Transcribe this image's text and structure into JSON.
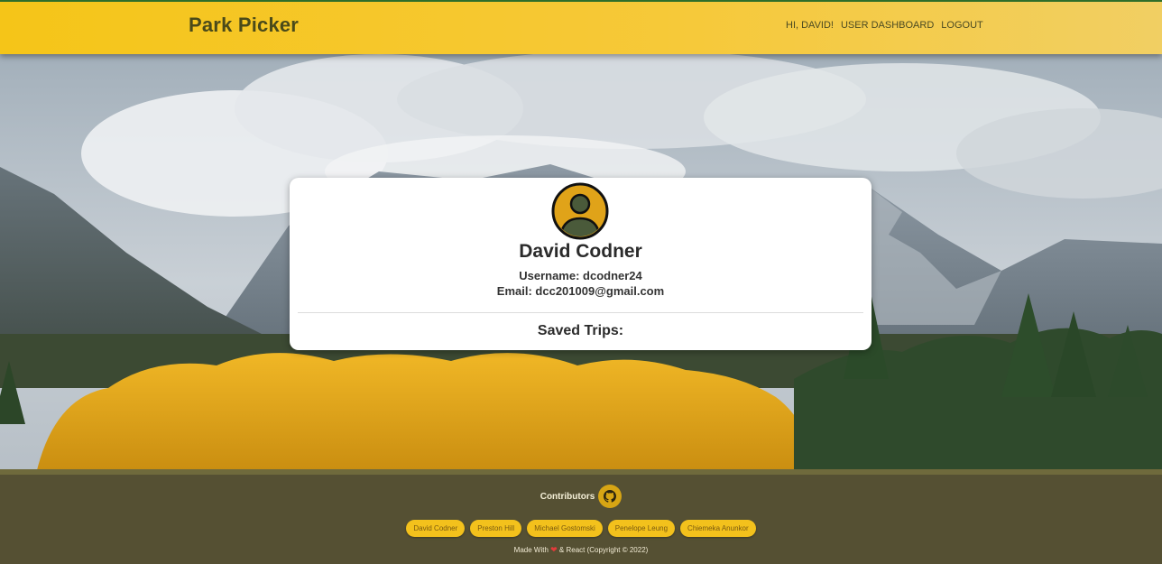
{
  "navbar": {
    "brand": "Park Picker",
    "links": [
      "HI, DAVID!",
      "USER DASHBOARD",
      "LOGOUT"
    ]
  },
  "profile": {
    "name": "David Codner",
    "username_label": "Username: dcodner24",
    "email_label": "Email: dcc201009@gmail.com",
    "saved_trips_label": "Saved Trips:"
  },
  "footer": {
    "contributors_label": "Contributors",
    "contributors": [
      "David Codner",
      "Preston Hill",
      "Michael Gostomski",
      "Penelope Leung",
      "Chiemeka Anunkor"
    ],
    "made_with_prefix": "Made With",
    "made_with_suffix": "& React (Copyright © 2022)"
  },
  "icons": {
    "avatar": "user-avatar-icon",
    "github": "github-icon",
    "heart": "heart-icon"
  },
  "colors": {
    "navbar": "#f5c518",
    "brand_text": "#4a4a1a",
    "chip": "#f3c11c",
    "avatar_ring": "#e0a319"
  }
}
